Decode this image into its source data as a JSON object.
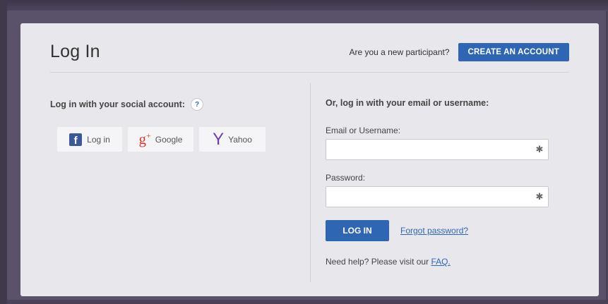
{
  "header": {
    "title": "Log In",
    "new_participant_text": "Are you a new participant?",
    "create_account_label": "CREATE AN ACCOUNT"
  },
  "social": {
    "heading": "Log in with your social account:",
    "help_label": "?",
    "buttons": [
      {
        "label": "Log in",
        "icon": "facebook-icon"
      },
      {
        "label": "Google",
        "icon": "google-plus-icon"
      },
      {
        "label": "Yahoo",
        "icon": "yahoo-icon"
      }
    ]
  },
  "email_login": {
    "heading": "Or, log in with your email or username:",
    "username_label": "Email or Username:",
    "username_value": "",
    "password_label": "Password:",
    "password_value": "",
    "login_button": "LOG IN",
    "forgot_link": "Forgot password?",
    "help_text": "Need help? Please visit our",
    "faq_link": "FAQ."
  },
  "colors": {
    "accent": "#2f66b3",
    "card_bg": "#e8e8ec",
    "backdrop": "#4a4358"
  }
}
